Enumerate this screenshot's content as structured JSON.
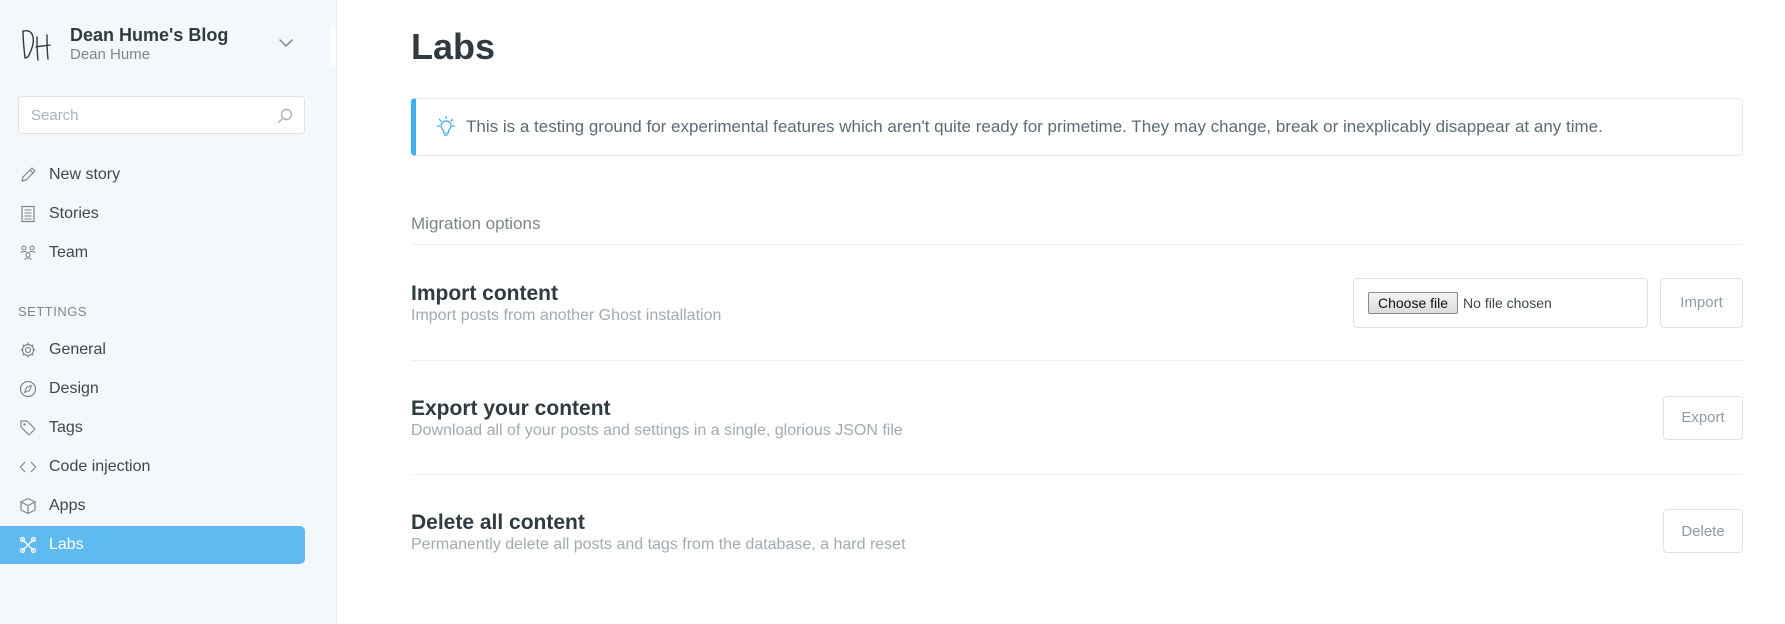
{
  "blog": {
    "title": "Dean Hume's Blog",
    "user": "Dean Hume",
    "logo_icon": "dh-signature-logo"
  },
  "search": {
    "placeholder": "Search"
  },
  "nav": {
    "primary": [
      {
        "label": "New story",
        "icon": "pencil-icon"
      },
      {
        "label": "Stories",
        "icon": "document-list-icon"
      },
      {
        "label": "Team",
        "icon": "team-icon"
      }
    ],
    "settings_heading": "SETTINGS",
    "settings": [
      {
        "label": "General",
        "icon": "gear-icon"
      },
      {
        "label": "Design",
        "icon": "compass-icon"
      },
      {
        "label": "Tags",
        "icon": "tag-icon"
      },
      {
        "label": "Code injection",
        "icon": "code-icon"
      },
      {
        "label": "Apps",
        "icon": "box-icon"
      },
      {
        "label": "Labs",
        "icon": "labs-icon",
        "active": true
      }
    ]
  },
  "main": {
    "title": "Labs",
    "notice": "This is a testing ground for experimental features which aren't quite ready for primetime. They may change, break or inexplicably disappear at any time.",
    "section_label": "Migration options",
    "import": {
      "title": "Import content",
      "description": "Import posts from another Ghost installation",
      "choose_file_label": "Choose file",
      "file_status": "No file chosen",
      "button_label": "Import"
    },
    "export": {
      "title": "Export your content",
      "description": "Download all of your posts and settings in a single, glorious JSON file",
      "button_label": "Export"
    },
    "delete": {
      "title": "Delete all content",
      "description": "Permanently delete all posts and tags from the database, a hard reset",
      "button_label": "Delete"
    }
  },
  "colors": {
    "accent": "#5ebaf0",
    "notice_border": "#3eb0ef",
    "sidebar_bg": "#f4f8fb"
  }
}
